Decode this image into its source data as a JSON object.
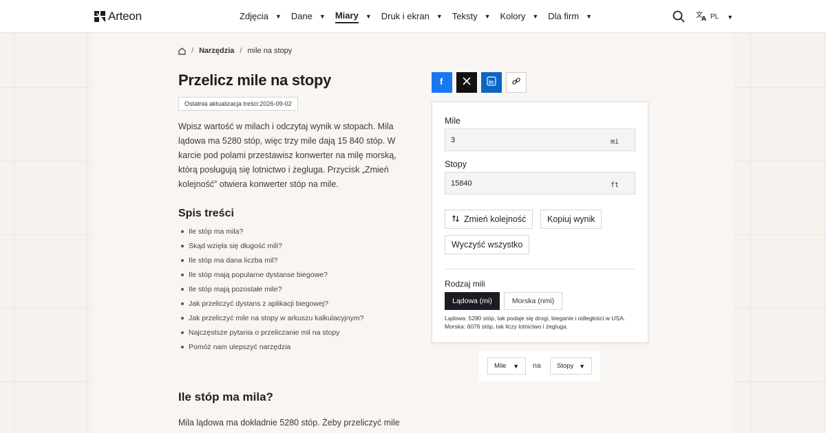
{
  "header": {
    "logo_text": "Arteon",
    "nav": [
      {
        "label": "Zdjęcia",
        "active": false
      },
      {
        "label": "Dane",
        "active": false
      },
      {
        "label": "Miary",
        "active": true
      },
      {
        "label": "Druk i ekran",
        "active": false
      },
      {
        "label": "Teksty",
        "active": false
      },
      {
        "label": "Kolory",
        "active": false
      },
      {
        "label": "Dla firm",
        "active": false
      }
    ],
    "caret": "▼",
    "lang": "PL"
  },
  "breadcrumb": {
    "section": "Narzędzia",
    "current": "mile na stopy",
    "separator": "/"
  },
  "article": {
    "title": "Przelicz mile na stopy",
    "updated": "Ostatnia aktualizacja treści:2026-09-02",
    "intro": "Wpisz wartość w milach i odczytaj wynik w stopach. Mila lądowa ma 5280 stóp, więc trzy mile dają 15 840 stóp. W karcie pod polami przestawisz konwerter na milę morską, którą posługują się lotnictwo i żegluga. Przycisk „Zmień kolejność” otwiera konwerter stóp na mile.",
    "toc_title": "Spis treści",
    "toc": [
      "Ile stóp ma mila?",
      "Skąd wzięła się długość mili?",
      "Ile stóp ma dana liczba mil?",
      "Ile stóp mają popularne dystanse biegowe?",
      "Ile stóp mają pozostałe mile?",
      "Jak przeliczyć dystans z aplikacji biegowej?",
      "Jak przeliczyć mile na stopy w arkuszu kalkulacyjnym?",
      "Najczęstsze pytania o przeliczanie mil na stopy",
      "Pomóż nam ulepszyć narzędzia"
    ],
    "h2": "Ile stóp ma mila?",
    "para2": "Mila lądowa ma dokładnie 5280 stóp. Żeby przeliczyć mile"
  },
  "share": {
    "facebook": "f",
    "x": "X",
    "linkedin": "in"
  },
  "converter": {
    "from_label": "Mile",
    "from_value": "3",
    "from_unit": "mi",
    "to_label": "Stopy",
    "to_value": "15840",
    "to_unit": "ft",
    "swap_label": "Zmień kolejność",
    "copy_label": "Kopiuj wynik",
    "clear_label": "Wyczyść wszystko",
    "kind_label": "Rodzaj mili",
    "kind_options": [
      "Lądowa (mi)",
      "Morska (nmi)"
    ],
    "kind_selected": "Lądowa (mi)",
    "hint": "Lądowa: 5280 stóp, tak podaje się drogi, bieganie i odległości w USA. Morska: 6076 stóp, tak liczy lotnictwo i żegluga."
  },
  "unit_selector": {
    "from": "Mile",
    "connector": "na",
    "to": "Stopy"
  }
}
